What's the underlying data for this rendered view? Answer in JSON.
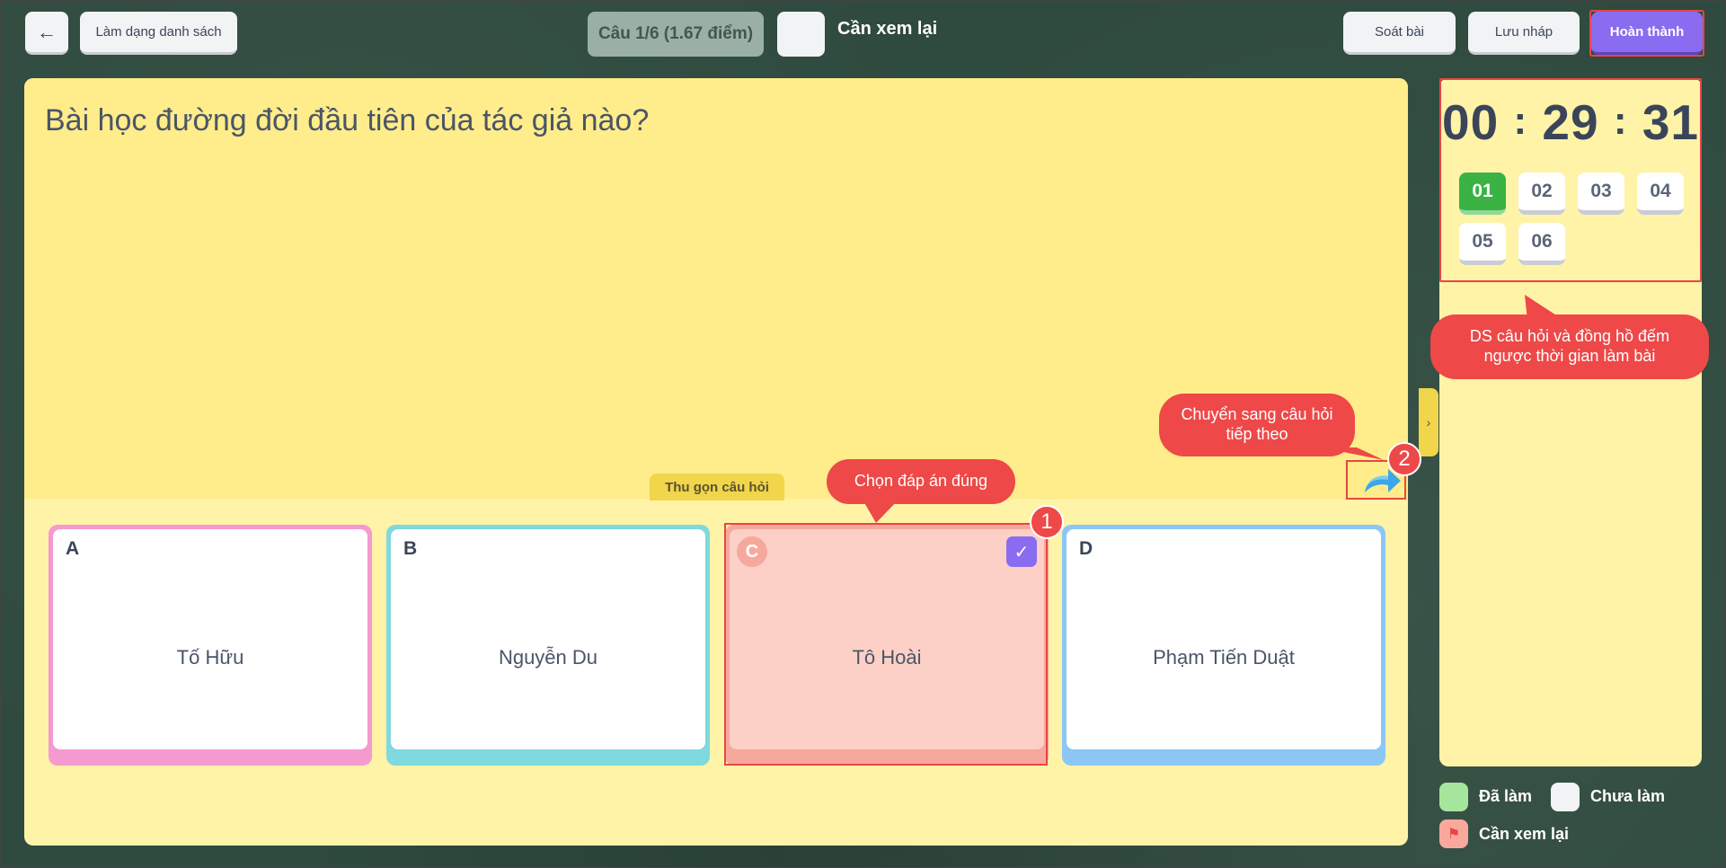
{
  "header": {
    "back_icon": "arrow-left-icon",
    "list_mode_label": "Làm dạng danh sách",
    "question_indicator": "Câu 1/6 (1.67 điểm)",
    "review_label": "Cần xem lại",
    "check_label": "Soát bài",
    "draft_label": "Lưu nháp",
    "finish_label": "Hoàn thành"
  },
  "question": {
    "text": "Bài học đường đời đầu tiên của tác giả nào?",
    "collapse_label": "Thu gọn câu hỏi"
  },
  "answers": [
    {
      "letter": "A",
      "text": "Tố Hữu",
      "selected": false
    },
    {
      "letter": "B",
      "text": "Nguyễn Du",
      "selected": false
    },
    {
      "letter": "C",
      "text": "Tô Hoài",
      "selected": true
    },
    {
      "letter": "D",
      "text": "Phạm Tiến Duật",
      "selected": false
    }
  ],
  "timer": {
    "hours": "00",
    "minutes": "29",
    "seconds": "31",
    "sep": ":"
  },
  "question_list": [
    {
      "label": "01",
      "status": "done"
    },
    {
      "label": "02",
      "status": "todo"
    },
    {
      "label": "03",
      "status": "todo"
    },
    {
      "label": "04",
      "status": "todo"
    },
    {
      "label": "05",
      "status": "todo"
    },
    {
      "label": "06",
      "status": "todo"
    }
  ],
  "legend": {
    "done": "Đã làm",
    "todo": "Chưa làm",
    "review": "Cần xem lại"
  },
  "callouts": {
    "side_panel": "DS câu hỏi  và đồng hồ đếm ngược thời gian làm bài",
    "next_question": "Chuyển sang câu hỏi tiếp theo",
    "choose_answer": "Chọn đáp án đúng",
    "badge_1": "1",
    "badge_2": "2"
  },
  "colors": {
    "accent": "#8a6cf0",
    "done_green": "#3ab244",
    "callout_red": "#ee4848",
    "question_bg": "#ffec8a"
  }
}
